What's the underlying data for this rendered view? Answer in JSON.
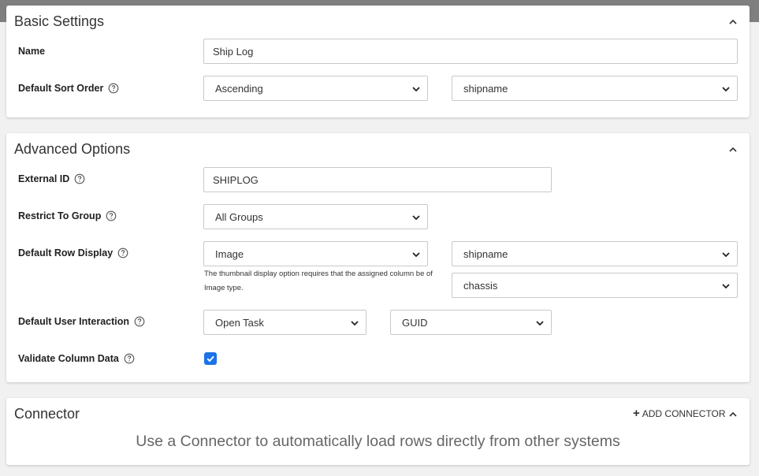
{
  "basic": {
    "title": "Basic Settings",
    "name_label": "Name",
    "name_value": "Ship Log",
    "sort_label": "Default Sort Order",
    "sort_direction": "Ascending",
    "sort_column": "shipname"
  },
  "advanced": {
    "title": "Advanced Options",
    "external_id_label": "External ID",
    "external_id_value": "SHIPLOG",
    "restrict_label": "Restrict To Group",
    "restrict_value": "All Groups",
    "row_display_label": "Default Row Display",
    "row_display_value": "Image",
    "row_display_column_1": "shipname",
    "row_display_column_2": "chassis",
    "row_display_hint": "The thumbnail display option requires that the assigned column be of Image type.",
    "interaction_label": "Default User Interaction",
    "interaction_value": "Open Task",
    "interaction_column": "GUID",
    "validate_label": "Validate Column Data",
    "validate_checked": true
  },
  "connector": {
    "title": "Connector",
    "add_label": "ADD CONNECTOR",
    "message": "Use a Connector to automatically load rows directly from other systems"
  },
  "colors": {
    "accent": "#1a73e8",
    "page_bg": "#f1f1f1",
    "topbar": "#7f7f7f"
  },
  "icons": [
    "chevron-up-icon",
    "help-circle-icon",
    "chevron-down-icon",
    "checkmark-icon",
    "plus-icon"
  ]
}
